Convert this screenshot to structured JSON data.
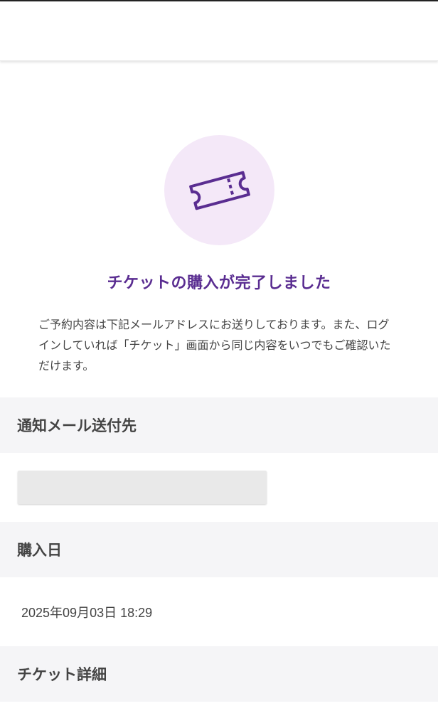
{
  "colors": {
    "accent": "#5a2d91",
    "icon_bg": "#f4e8f8",
    "section_bg": "#f5f5f7"
  },
  "confirmation": {
    "icon": "ticket-icon",
    "title": "チケットの購入が完了しました",
    "description": "ご予約内容は下記メールアドレスにお送りしております。また、ログインしていれば「チケット」画面から同じ内容をいつでもご確認いただけます。"
  },
  "sections": {
    "email": {
      "heading": "通知メール送付先",
      "value": ""
    },
    "purchase_date": {
      "heading": "購入日",
      "value": "2025年09月03日 18:29"
    },
    "ticket_detail": {
      "heading": "チケット詳細"
    }
  }
}
